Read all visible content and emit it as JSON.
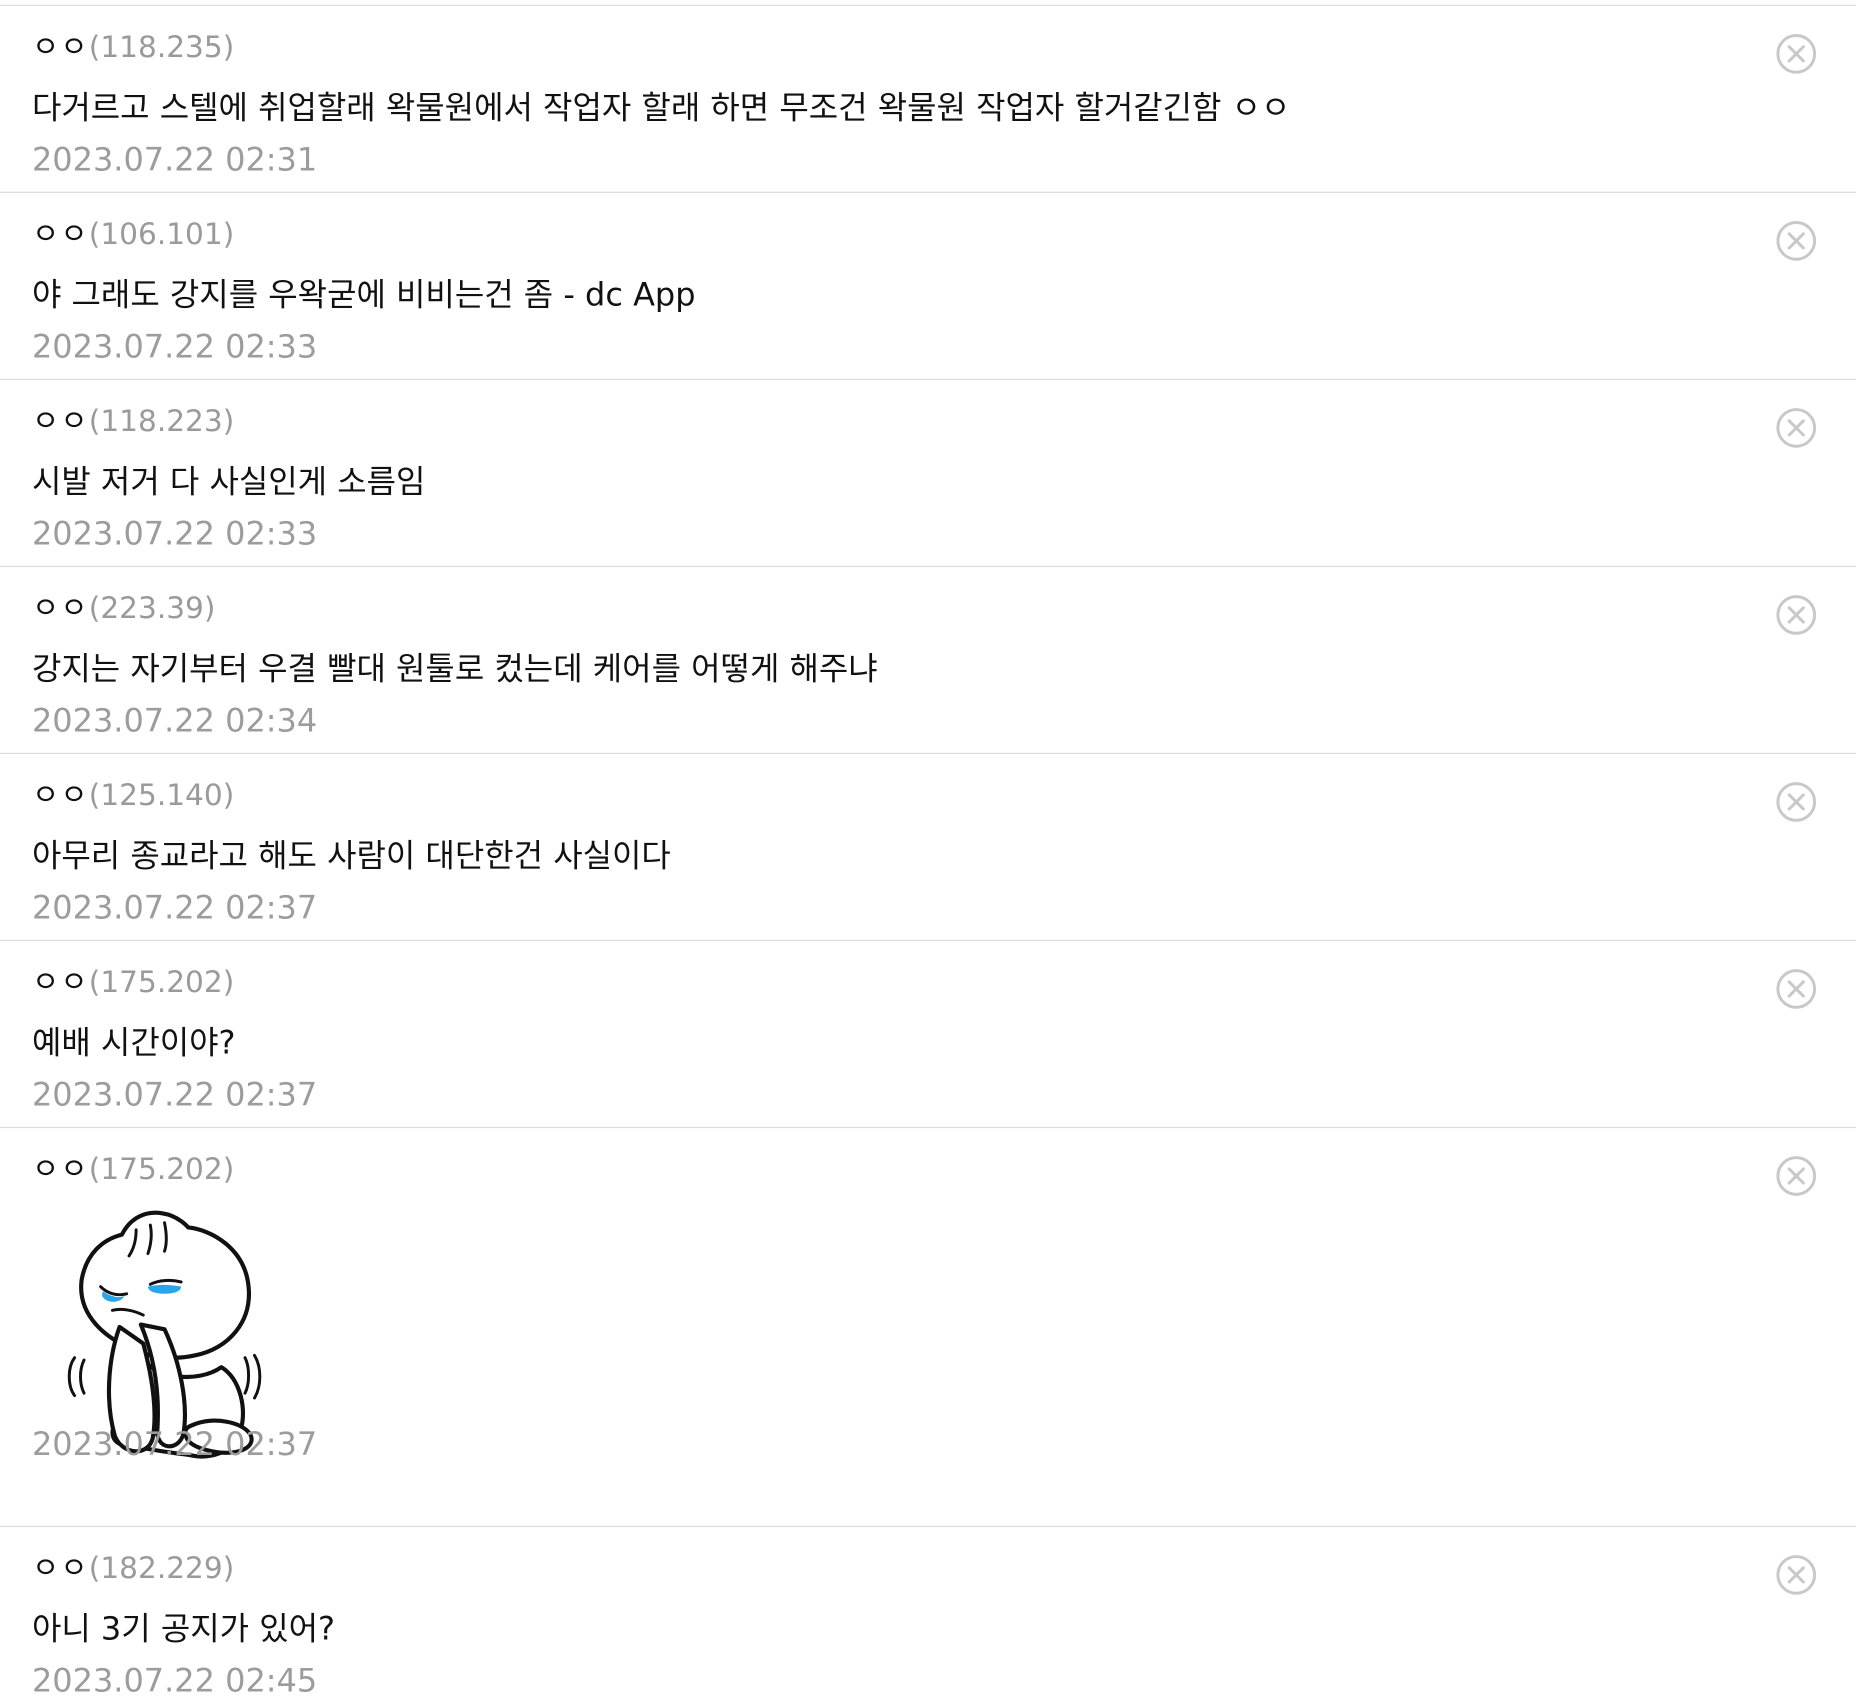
{
  "colors": {
    "divider": "#dcdcdc",
    "ip": "#9a9a9a",
    "date": "#9c9c9c",
    "text": "#111111",
    "delete_icon": "#c8c8c8"
  },
  "comments": [
    {
      "nickname": "ㅇㅇ",
      "ip": "(118.235)",
      "text": "다거르고 스텔에 취업할래 왁물원에서 작업자 할래 하면 무조건 왁물원 작업자 할거같긴함 ㅇㅇ",
      "date": "2023.07.22 02:31",
      "delete_icon": "close-circle-icon"
    },
    {
      "nickname": "ㅇㅇ",
      "ip": "(106.101)",
      "text": "야 그래도 강지를 우왁굳에 비비는건 좀 - dc App",
      "date": "2023.07.22 02:33",
      "delete_icon": "close-circle-icon"
    },
    {
      "nickname": "ㅇㅇ",
      "ip": "(118.223)",
      "text": "시발 저거 다 사실인게 소름임",
      "date": "2023.07.22 02:33",
      "delete_icon": "close-circle-icon"
    },
    {
      "nickname": "ㅇㅇ",
      "ip": "(223.39)",
      "text": "강지는 자기부터 우결 빨대 원툴로 컸는데 케어를 어떻게 해주냐",
      "date": "2023.07.22 02:34",
      "delete_icon": "close-circle-icon"
    },
    {
      "nickname": "ㅇㅇ",
      "ip": "(125.140)",
      "text": "아무리 종교라고 해도 사람이 대단한건 사실이다",
      "date": "2023.07.22 02:37",
      "delete_icon": "close-circle-icon"
    },
    {
      "nickname": "ㅇㅇ",
      "ip": "(175.202)",
      "text": "예배 시간이야?",
      "date": "2023.07.22 02:37",
      "delete_icon": "close-circle-icon"
    },
    {
      "nickname": "ㅇㅇ",
      "ip": "(175.202)",
      "sticker": "crying-kneeling-dumpling-character-praying-sticker",
      "date": "2023.07.22 02:37",
      "delete_icon": "close-circle-icon"
    },
    {
      "nickname": "ㅇㅇ",
      "ip": "(182.229)",
      "text": "아니 3기 공지가 있어?",
      "date": "2023.07.22 02:45",
      "delete_icon": "close-circle-icon"
    }
  ]
}
